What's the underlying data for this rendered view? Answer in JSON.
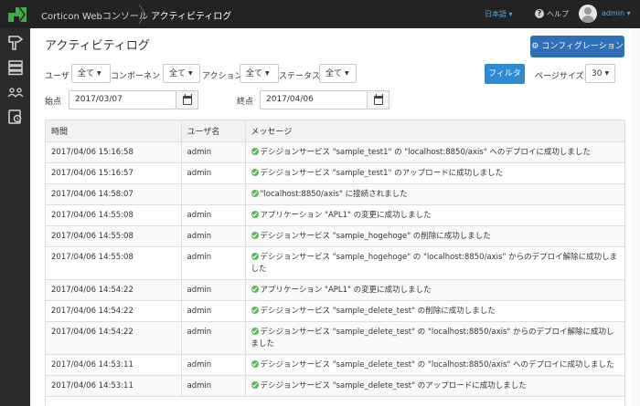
{
  "header": {
    "brand": "Corticon Webコンソール",
    "breadcrumb": "アクティビティログ",
    "language": "日本語 ▾",
    "help": "ヘルプ",
    "user": "admin ▾"
  },
  "sidebar": {
    "items": [
      {
        "icon": "tools-icon"
      },
      {
        "icon": "server-icon"
      },
      {
        "icon": "users-icon"
      },
      {
        "icon": "activity-log-icon"
      }
    ]
  },
  "page": {
    "title": "アクティビティログ",
    "config_button": "コンフィグレーション"
  },
  "filters": {
    "user_label": "ユーザ",
    "user_value": "全て",
    "component_label": "コンポーネント",
    "component_value": "全て",
    "action_label": "アクション",
    "action_value": "全て",
    "status_label": "ステータス",
    "status_value": "全て",
    "filter_button": "フィルタ",
    "page_size_label": "ページサイズ",
    "page_size_value": "30",
    "start_label": "始点",
    "start_date": "2017/03/07",
    "end_label": "終点",
    "end_date": "2017/04/06"
  },
  "table": {
    "columns": [
      "時間",
      "ユーザ名",
      "メッセージ"
    ],
    "rows": [
      {
        "time": "2017/04/06 15:16:58",
        "user": "admin",
        "message": "デシジョンサービス \"sample_test1\" の \"localhost:8850/axis\" へのデプロイに成功しました",
        "tall": false
      },
      {
        "time": "2017/04/06 15:16:57",
        "user": "admin",
        "message": "デシジョンサービス \"sample_test1\" のアップロードに成功しました",
        "tall": false
      },
      {
        "time": "2017/04/06 14:58:07",
        "user": "",
        "message": "\"localhost:8850/axis\" に接続されました",
        "tall": false
      },
      {
        "time": "2017/04/06 14:55:08",
        "user": "admin",
        "message": "アプリケーション \"APL1\" の変更に成功しました",
        "tall": false
      },
      {
        "time": "2017/04/06 14:55:08",
        "user": "admin",
        "message": "デシジョンサービス \"sample_hogehoge\" の削除に成功しました",
        "tall": false
      },
      {
        "time": "2017/04/06 14:55:08",
        "user": "admin",
        "message": "デシジョンサービス \"sample_hogehoge\" の \"localhost:8850/axis\" からのデプロイ解除に成功しました",
        "tall": true
      },
      {
        "time": "2017/04/06 14:54:22",
        "user": "admin",
        "message": "アプリケーション \"APL1\" の変更に成功しました",
        "tall": false
      },
      {
        "time": "2017/04/06 14:54:22",
        "user": "admin",
        "message": "デシジョンサービス \"sample_delete_test\" の削除に成功しました",
        "tall": false
      },
      {
        "time": "2017/04/06 14:54:22",
        "user": "admin",
        "message": "デシジョンサービス \"sample_delete_test\" の \"localhost:8850/axis\" からのデプロイ解除に成功しました",
        "tall": true
      },
      {
        "time": "2017/04/06 14:53:11",
        "user": "admin",
        "message": "デシジョンサービス \"sample_delete_test\" の \"localhost:8850/axis\" へのデプロイに成功しました",
        "tall": false
      },
      {
        "time": "2017/04/06 14:53:11",
        "user": "admin",
        "message": "デシジョンサービス \"sample_delete_test\" のアップロードに成功しました",
        "tall": false
      }
    ]
  },
  "colors": {
    "topbar": "#232323",
    "sidebar": "#2b2b2b",
    "primary": "#2f6fb5",
    "filter": "#2f8ad6",
    "success": "#5cb85c",
    "logo": "#3fae49"
  }
}
